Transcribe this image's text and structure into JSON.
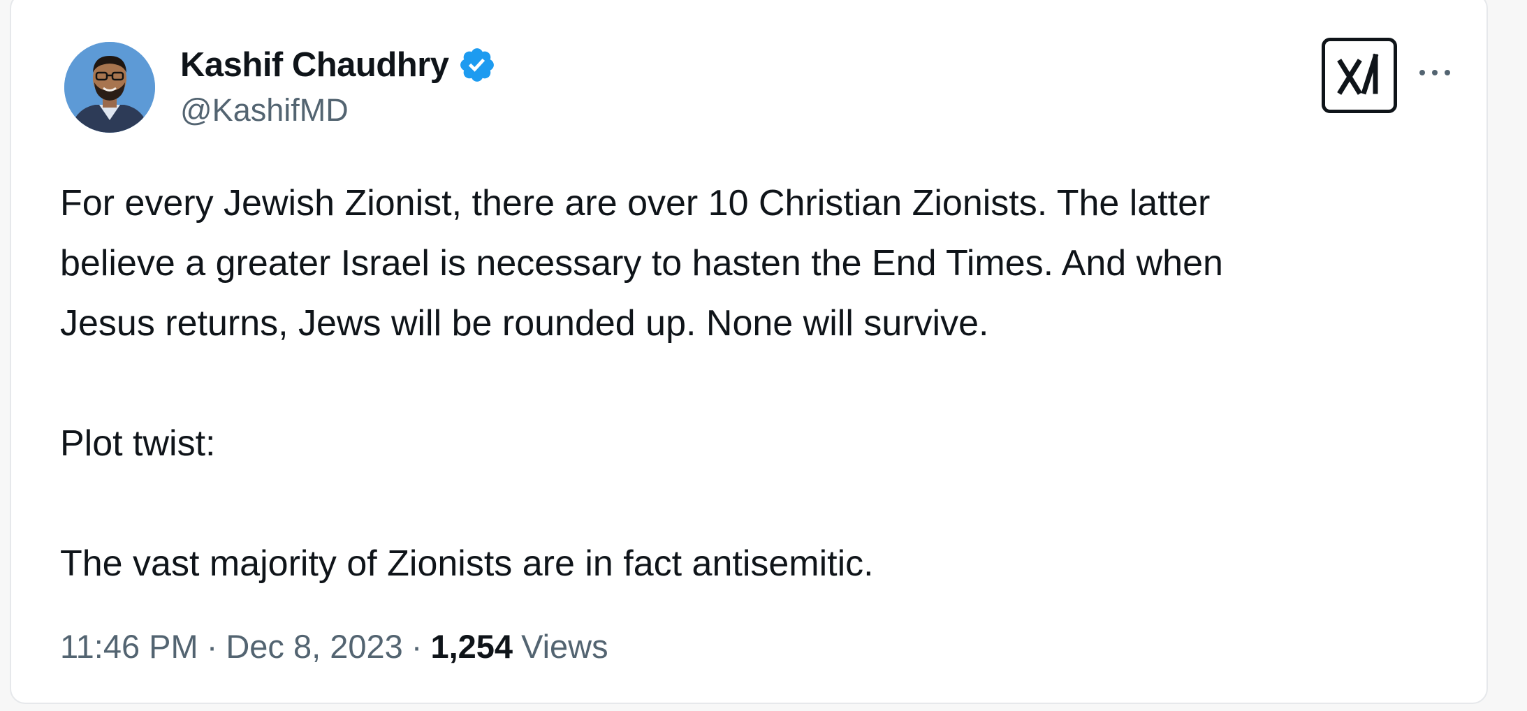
{
  "tweet": {
    "author": {
      "display_name": "Kashif Chaudhry",
      "handle": "@KashifMD",
      "verified": true,
      "verified_color": "#1d9bf0"
    },
    "paragraphs": [
      "For every Jewish Zionist, there are over 10 Christian Zionists. The latter\nbelieve a greater Israel is necessary to hasten the End Times. And when\nJesus returns, Jews will be rounded up. None will survive.",
      "Plot twist:",
      "The vast majority of Zionists are in fact antisemitic."
    ],
    "time": "11:46 PM",
    "date": "Dec 8, 2023",
    "separator": "·",
    "views_count": "1,254",
    "views_label": "Views"
  },
  "icons": {
    "logo": "grok-x-logo-icon",
    "more": "more-horizontal-icon",
    "verified": "verified-badge-icon"
  },
  "colors": {
    "text_primary": "#0f1419",
    "text_secondary": "#536471",
    "accent": "#1d9bf0",
    "card_border": "#e6e8eb"
  }
}
